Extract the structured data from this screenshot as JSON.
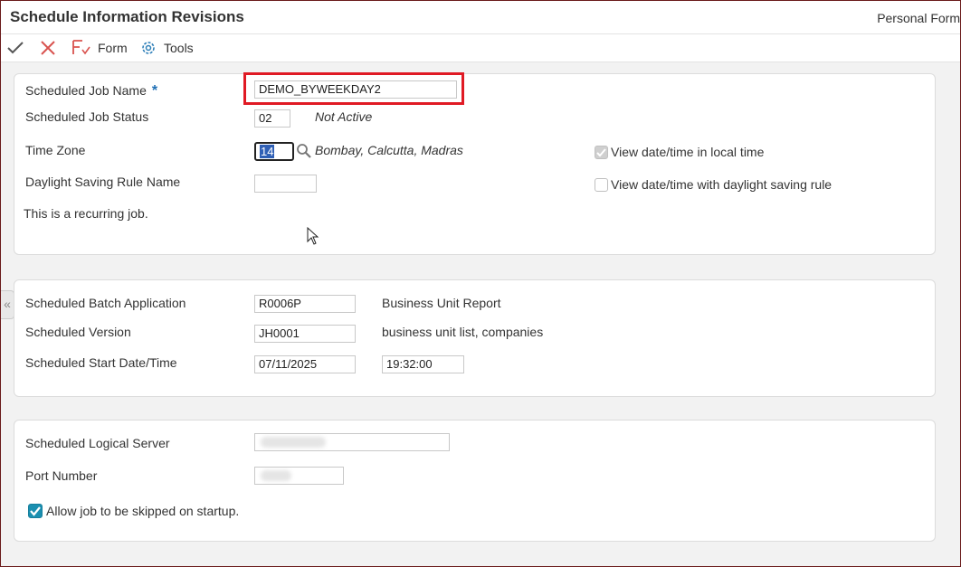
{
  "header": {
    "title": "Schedule Information Revisions",
    "personal_form": "Personal Form"
  },
  "toolbar": {
    "form_label": "Form",
    "tools_label": "Tools"
  },
  "job": {
    "name_label": "Scheduled Job Name",
    "required_marker": "*",
    "name_value": "DEMO_BYWEEKDAY2",
    "status_label": "Scheduled Job Status",
    "status_value": "02",
    "status_desc": "Not Active",
    "timezone_label": "Time Zone",
    "timezone_value": "14",
    "timezone_desc": "Bombay, Calcutta, Madras",
    "dst_label": "Daylight Saving Rule Name",
    "dst_value": "",
    "recurring_note": "This is a recurring job.",
    "local_time_label": "View date/time in local time",
    "local_time_checked": true,
    "dst_view_label": "View date/time with daylight saving rule",
    "dst_view_checked": false
  },
  "batch": {
    "app_label": "Scheduled Batch Application",
    "app_value": "R0006P",
    "app_desc": "Business Unit Report",
    "version_label": "Scheduled Version",
    "version_value": "JH0001",
    "version_desc": "business unit list, companies",
    "start_label": "Scheduled Start Date/Time",
    "start_date": "07/11/2025",
    "start_time": "19:32:00"
  },
  "server": {
    "logical_label": "Scheduled Logical Server",
    "port_label": "Port Number",
    "skip_label": "Allow job to be skipped on startup.",
    "skip_checked": true
  },
  "colors": {
    "highlight": "#e01a24",
    "checkbox_checked": "#1a8fb0",
    "required": "#1f6fb5"
  }
}
